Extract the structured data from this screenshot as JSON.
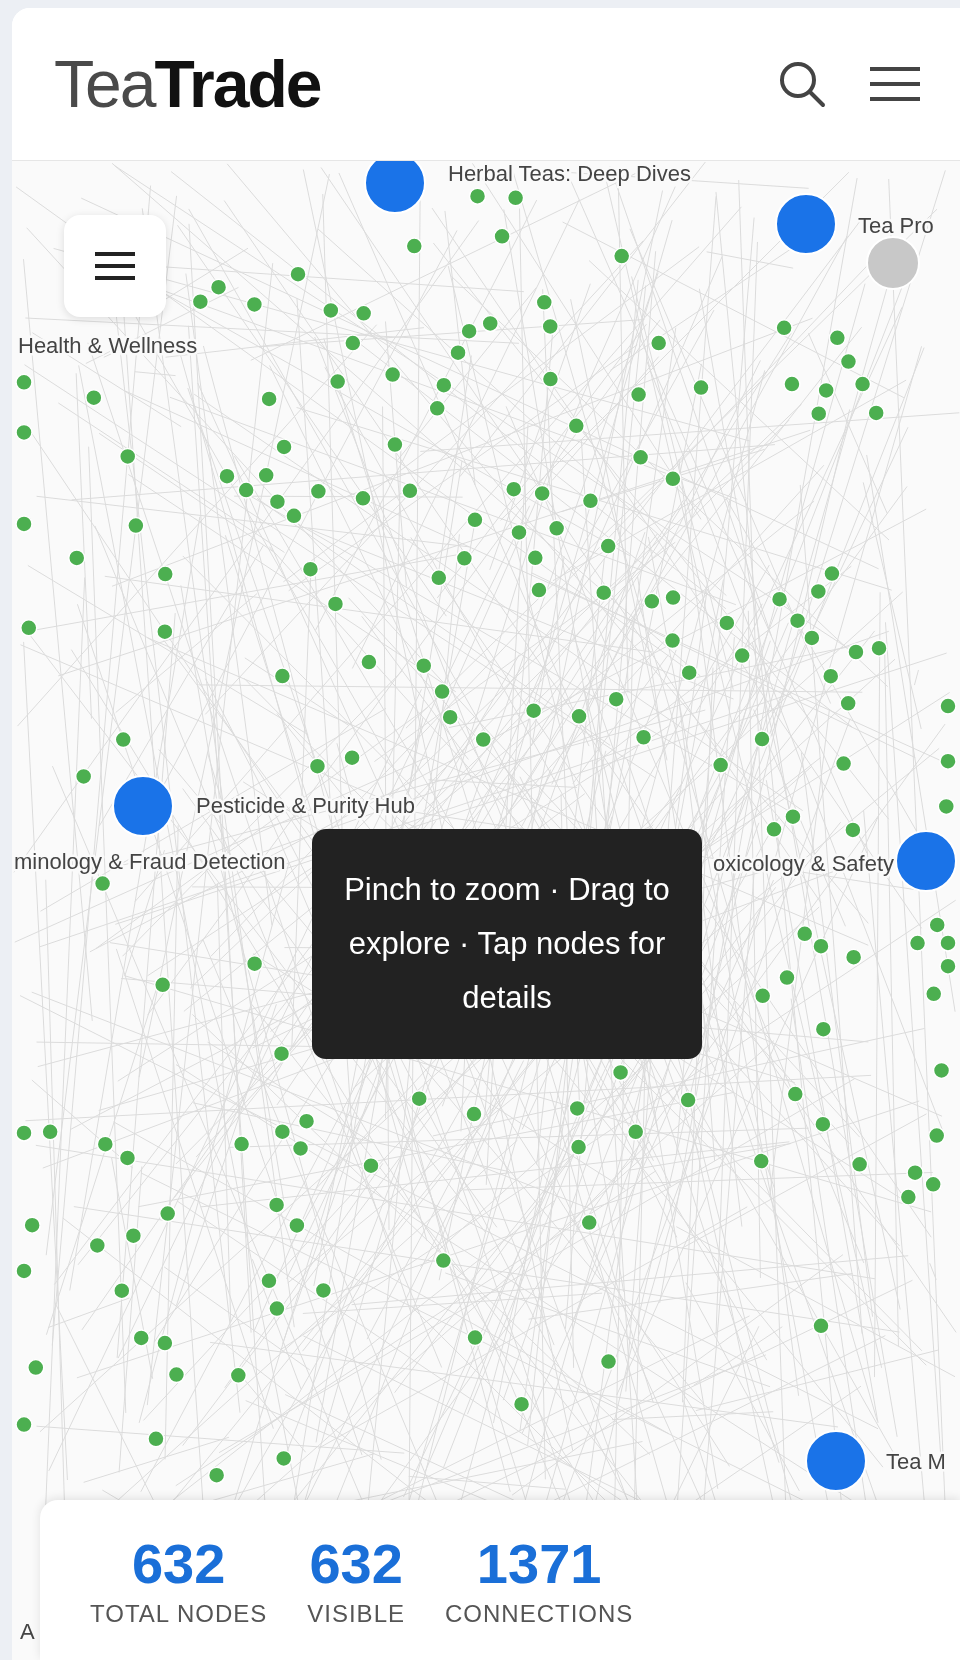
{
  "header": {
    "logo_first": "Tea",
    "logo_second": "Trade"
  },
  "graph": {
    "nodes": [
      {
        "kind": "hub",
        "label": "Herbal Teas: Deep Dives"
      },
      {
        "kind": "hub",
        "label": "Tea Pro"
      },
      {
        "kind": "muted"
      },
      {
        "kind": "text",
        "label": "Health & Wellness"
      },
      {
        "kind": "hub",
        "label": "Pesticide & Purity Hub"
      },
      {
        "kind": "text",
        "label": "minology & Fraud Detection"
      },
      {
        "kind": "hub",
        "label": "oxicology & Safety"
      },
      {
        "kind": "hub",
        "label": "Tea M"
      },
      {
        "kind": "text",
        "label": "A"
      }
    ]
  },
  "tooltip": "Pinch to zoom · Drag to explore · Tap nodes for details",
  "stats": [
    {
      "value": "632",
      "label": "TOTAL NODES"
    },
    {
      "value": "632",
      "label": "VISIBLE"
    },
    {
      "value": "1371",
      "label": "CONNECTIONS"
    }
  ]
}
